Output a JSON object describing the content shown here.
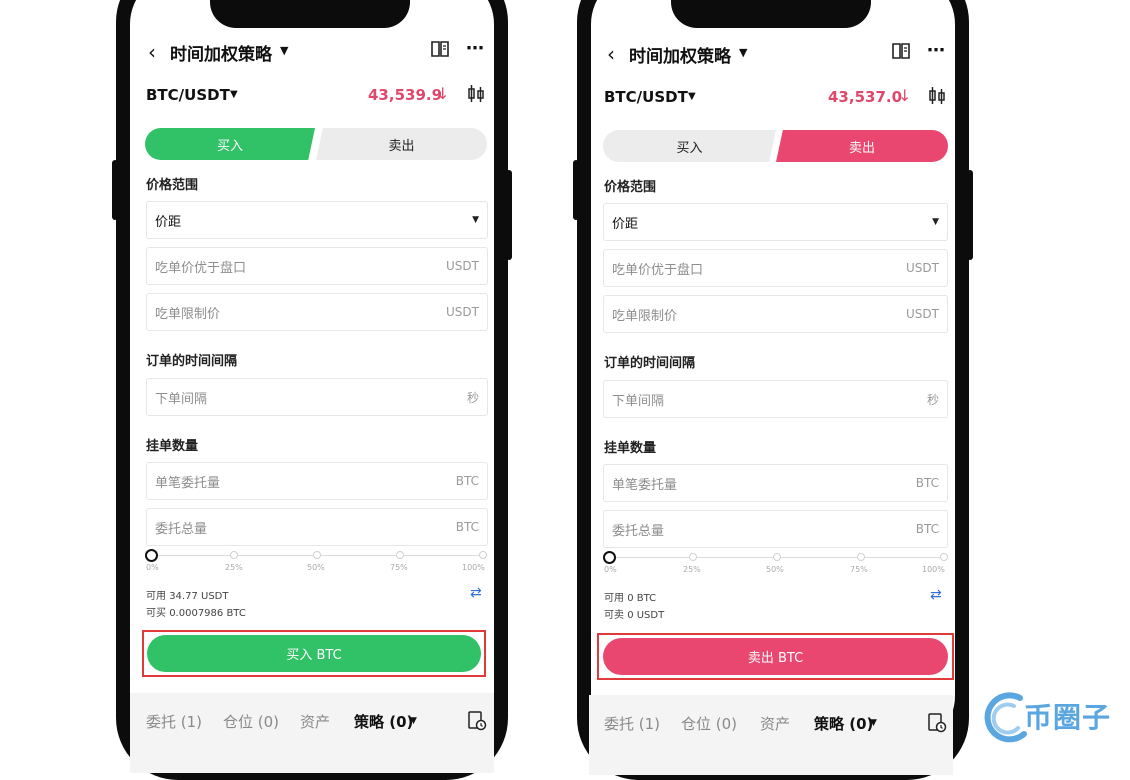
{
  "colors": {
    "buy_green": "#31c167",
    "sell_red": "#e9476f",
    "price_red": "#e0486b",
    "watermark_blue": "#5aa6e0"
  },
  "phones": [
    {
      "nav": {
        "title": "时间加权策略"
      },
      "pair": "BTC/USDT",
      "price": "43,539.9",
      "price_arrow": "↓",
      "tabs": {
        "buy": "买入",
        "sell": "卖出",
        "active": "buy"
      },
      "price_range": {
        "label": "价格范围",
        "select_value": "价距",
        "taker_better": {
          "placeholder": "吃单价优于盘口",
          "unit": "USDT"
        },
        "taker_limit": {
          "placeholder": "吃单限制价",
          "unit": "USDT"
        }
      },
      "interval": {
        "label": "订单的时间间隔",
        "placeholder": "下单间隔",
        "unit": "秒"
      },
      "quantity": {
        "label": "挂单数量",
        "single": {
          "placeholder": "单笔委托量",
          "unit": "BTC"
        },
        "total": {
          "placeholder": "委托总量",
          "unit": "BTC"
        }
      },
      "slider": {
        "ticks": [
          "0%",
          "25%",
          "50%",
          "75%",
          "100%"
        ],
        "value": 0
      },
      "available": {
        "label1": "可用",
        "value1": "34.77 USDT",
        "label2": "可买",
        "value2": "0.0007986 BTC"
      },
      "submit": "买入 BTC",
      "bottom_tabs": [
        "委托 (1)",
        "仓位 (0)",
        "资产",
        "策略 (0)"
      ],
      "bottom_active": 3
    },
    {
      "nav": {
        "title": "时间加权策略"
      },
      "pair": "BTC/USDT",
      "price": "43,537.0",
      "price_arrow": "↓",
      "tabs": {
        "buy": "买入",
        "sell": "卖出",
        "active": "sell"
      },
      "price_range": {
        "label": "价格范围",
        "select_value": "价距",
        "taker_better": {
          "placeholder": "吃单价优于盘口",
          "unit": "USDT"
        },
        "taker_limit": {
          "placeholder": "吃单限制价",
          "unit": "USDT"
        }
      },
      "interval": {
        "label": "订单的时间间隔",
        "placeholder": "下单间隔",
        "unit": "秒"
      },
      "quantity": {
        "label": "挂单数量",
        "single": {
          "placeholder": "单笔委托量",
          "unit": "BTC"
        },
        "total": {
          "placeholder": "委托总量",
          "unit": "BTC"
        }
      },
      "slider": {
        "ticks": [
          "0%",
          "25%",
          "50%",
          "75%",
          "100%"
        ],
        "value": 0
      },
      "available": {
        "label1": "可用",
        "value1": "0 BTC",
        "label2": "可卖",
        "value2": "0 USDT"
      },
      "submit": "卖出 BTC",
      "bottom_tabs": [
        "委托 (1)",
        "仓位 (0)",
        "资产",
        "策略 (0)"
      ],
      "bottom_active": 3
    }
  ],
  "watermark": {
    "text": "币圈子"
  }
}
